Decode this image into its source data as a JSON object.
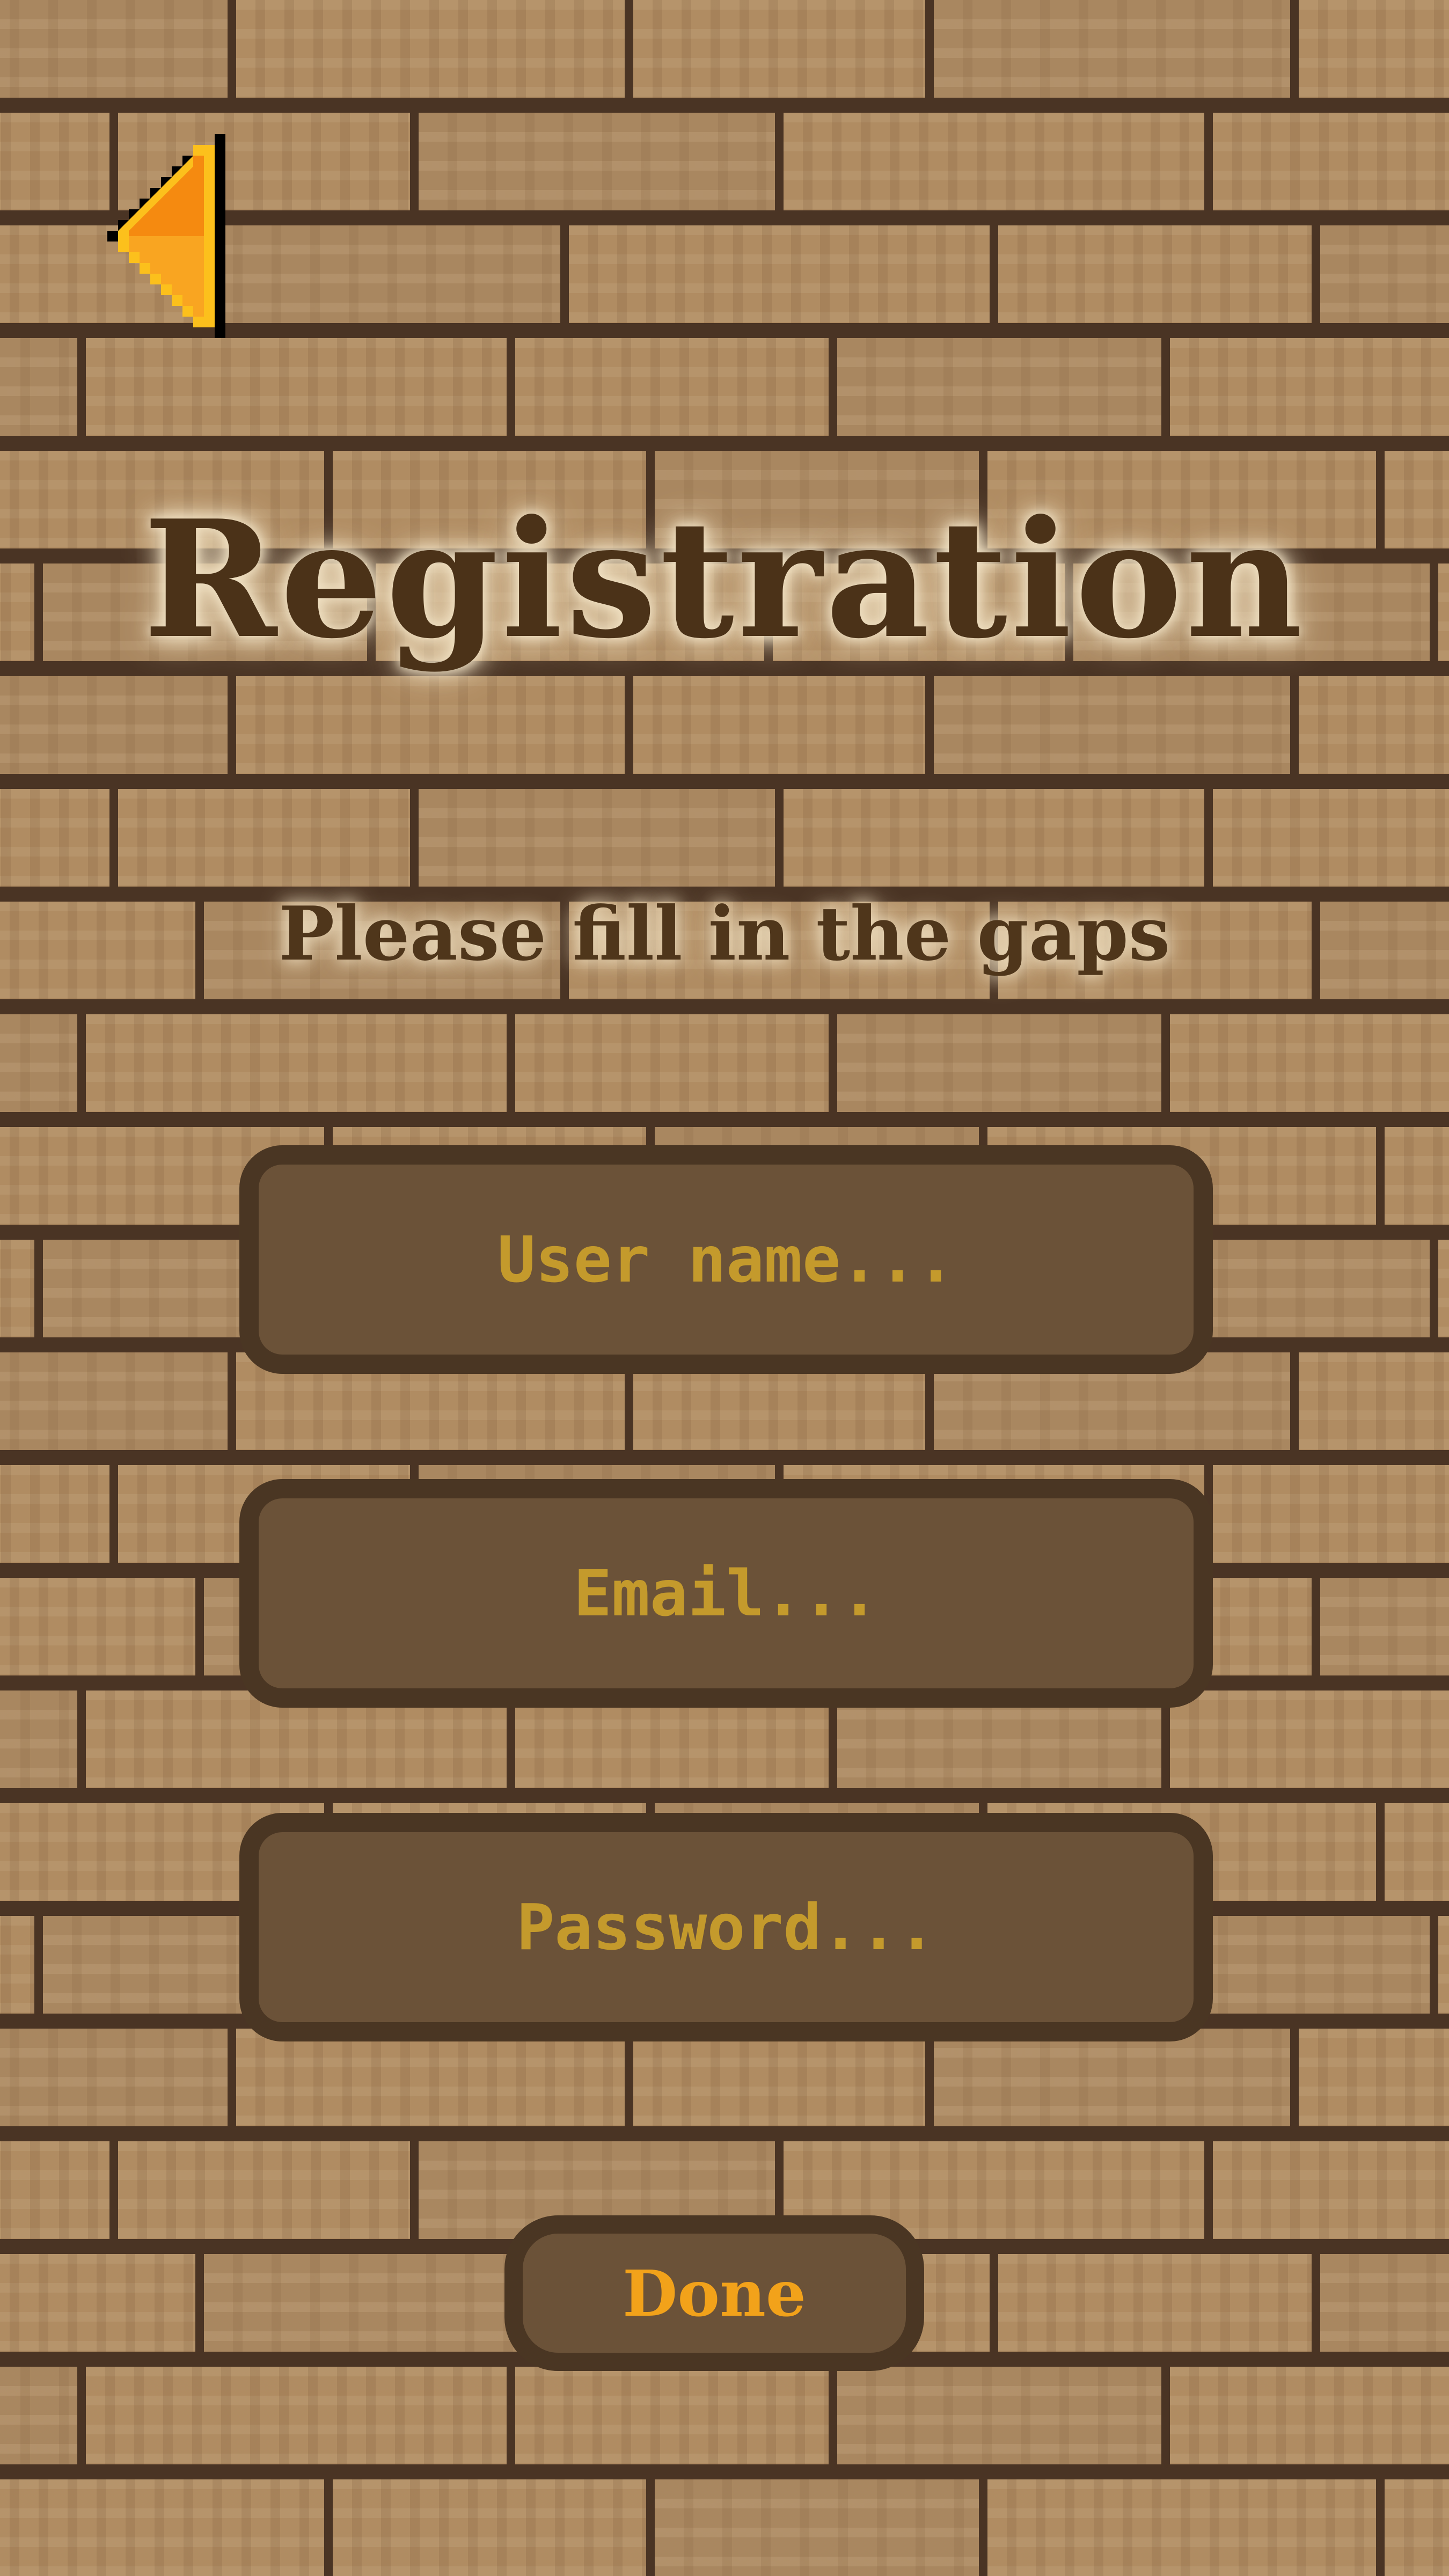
{
  "screen": {
    "title": "Registration",
    "subtitle": "Please fill in the gaps"
  },
  "back_button": {
    "icon": "arrow-left-icon"
  },
  "form": {
    "username": {
      "value": "",
      "placeholder": "User name..."
    },
    "email": {
      "value": "",
      "placeholder": "Email..."
    },
    "password": {
      "value": "",
      "placeholder": "Password..."
    }
  },
  "done_button": {
    "label": "Done"
  },
  "colors": {
    "brick": "#ad8a60",
    "mortar": "#4a3424",
    "title_text": "#4b3218",
    "field_fill": "#6b5238",
    "field_border": "#4a3623",
    "placeholder_text": "#c49a2c",
    "done_text": "#f2a21a",
    "arrow_fill": "#f58a10",
    "arrow_highlight": "#fcc01c"
  }
}
